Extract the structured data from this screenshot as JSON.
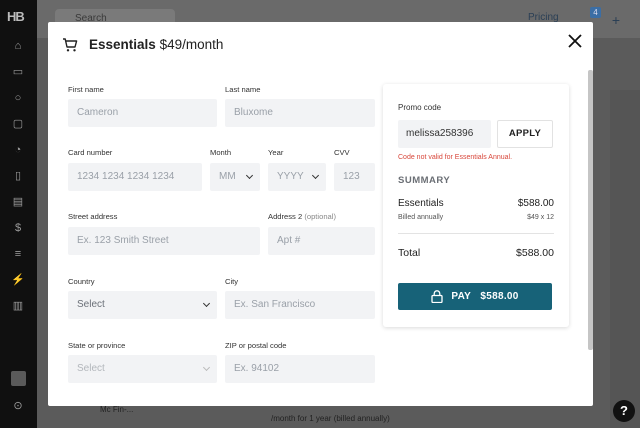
{
  "background": {
    "logo": "HB",
    "search_placeholder": "Search",
    "pricing": "Pricing",
    "notif_count": "4",
    "plus": "+",
    "bottom_text": "/month for 1 year (billed annually)",
    "bottom_left": "Mc Fin-...",
    "help": "?"
  },
  "modal": {
    "plan_name": "Essentials",
    "plan_price": "$49/month",
    "form": {
      "first_name": {
        "label": "First name",
        "placeholder": "Cameron"
      },
      "last_name": {
        "label": "Last name",
        "placeholder": "Bluxome"
      },
      "card_number": {
        "label": "Card number",
        "placeholder": "1234 1234 1234 1234"
      },
      "month": {
        "label": "Month",
        "value": "MM"
      },
      "year": {
        "label": "Year",
        "value": "YYYY"
      },
      "cvv": {
        "label": "CVV",
        "placeholder": "123"
      },
      "street": {
        "label": "Street address",
        "placeholder": "Ex. 123 Smith Street"
      },
      "address2": {
        "label": "Address 2",
        "label_optional": "(optional)",
        "placeholder": "Apt #"
      },
      "country": {
        "label": "Country",
        "value": "Select"
      },
      "city": {
        "label": "City",
        "placeholder": "Ex. San Francisco"
      },
      "state": {
        "label": "State or province",
        "value": "Select"
      },
      "zip": {
        "label": "ZIP or postal code",
        "placeholder": "Ex. 94102"
      }
    },
    "summary": {
      "promo_label": "Promo code",
      "promo_value": "melissa258396",
      "apply_label": "APPLY",
      "promo_error": "Code not valid for Essentials Annual.",
      "title": "SUMMARY",
      "item_name": "Essentials",
      "item_price": "$588.00",
      "billing": "Billed annually",
      "billing_detail": "$49 x 12",
      "total_label": "Total",
      "total_price": "$588.00",
      "pay_label": "PAY",
      "pay_amount": "$588.00"
    }
  },
  "colors": {
    "pay_button": "#176278",
    "error": "#d8473b",
    "field_bg": "#f2f3f5"
  }
}
